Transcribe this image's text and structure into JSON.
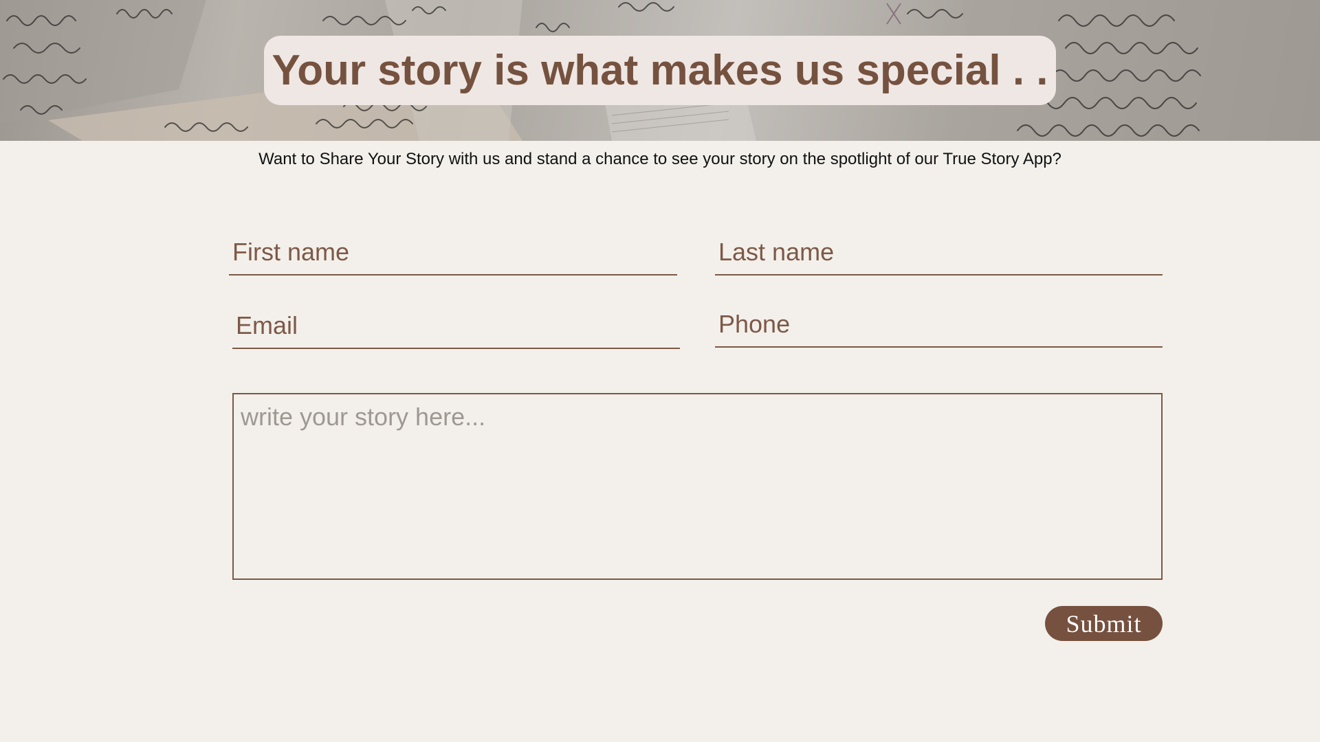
{
  "banner": {
    "title": "Your story is what makes us special . ."
  },
  "intro": {
    "text": "Want to Share Your Story with us and stand a chance to see your story on the spotlight of our True Story App?"
  },
  "form": {
    "first_name": {
      "placeholder": "First name",
      "value": ""
    },
    "last_name": {
      "placeholder": "Last name",
      "value": ""
    },
    "email": {
      "placeholder": "Email",
      "value": ""
    },
    "phone": {
      "placeholder": "Phone",
      "value": ""
    },
    "story": {
      "placeholder": "write your story here...",
      "value": ""
    },
    "submit_label": "Submit"
  },
  "colors": {
    "accent": "#76513f",
    "background": "#f3f0eb",
    "title_pill": "#efe7e4",
    "story_placeholder": "#9e9893"
  }
}
